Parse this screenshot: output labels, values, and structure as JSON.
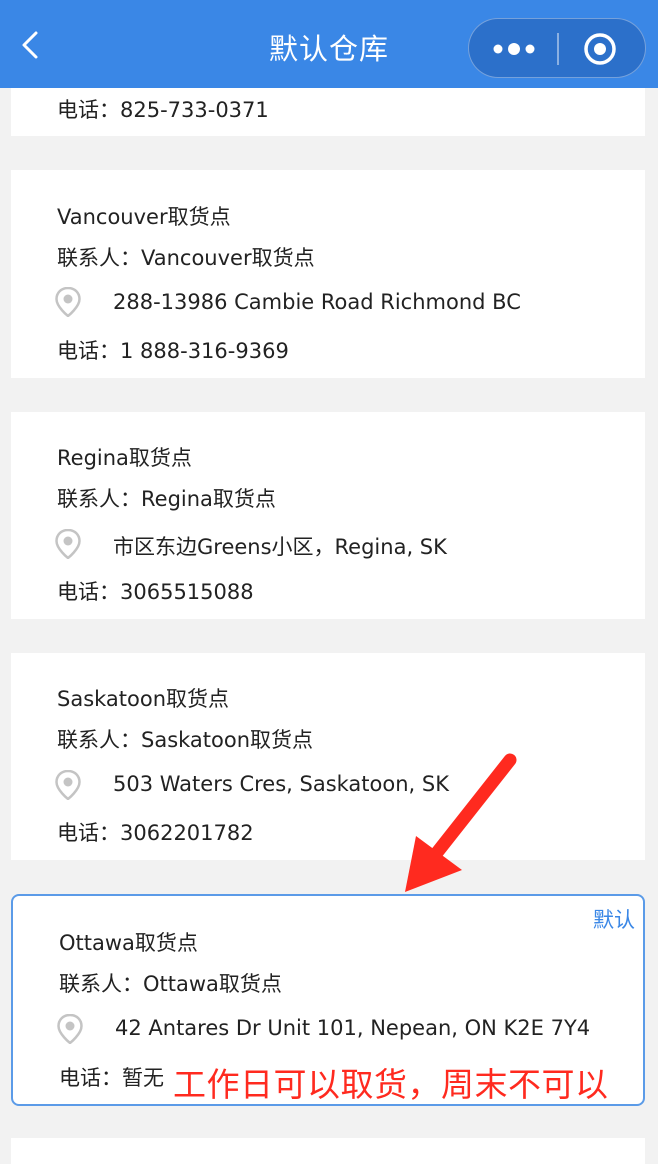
{
  "nav": {
    "title": "默认仓库"
  },
  "partial_card": {
    "phone": "电话：825-733-0371"
  },
  "cards": [
    {
      "name": "Vancouver取货点",
      "contact": "联系人：Vancouver取货点",
      "address": "288-13986 Cambie Road Richmond BC",
      "phone": "电话：1 888-316-9369"
    },
    {
      "name": "Regina取货点",
      "contact": "联系人：Regina取货点",
      "address": "市区东边Greens小区，Regina, SK",
      "phone": "电话：3065515088"
    },
    {
      "name": "Saskatoon取货点",
      "contact": "联系人：Saskatoon取货点",
      "address": "503 Waters Cres, Saskatoon, SK",
      "phone": "电话：3062201782"
    }
  ],
  "selected_card": {
    "default_label": "默认",
    "name": "Ottawa取货点",
    "contact": "联系人：Ottawa取货点",
    "address": "42 Antares Dr Unit 101, Nepean, ON K2E 7Y4",
    "phone": "电话：暂无"
  },
  "annotation": {
    "note": "工作日可以取货，周末不可以",
    "color": "#ff2a1f"
  },
  "colors": {
    "nav_bg": "#3a87e6",
    "page_bg": "#f2f2f2",
    "accent": "#3a87e6"
  }
}
